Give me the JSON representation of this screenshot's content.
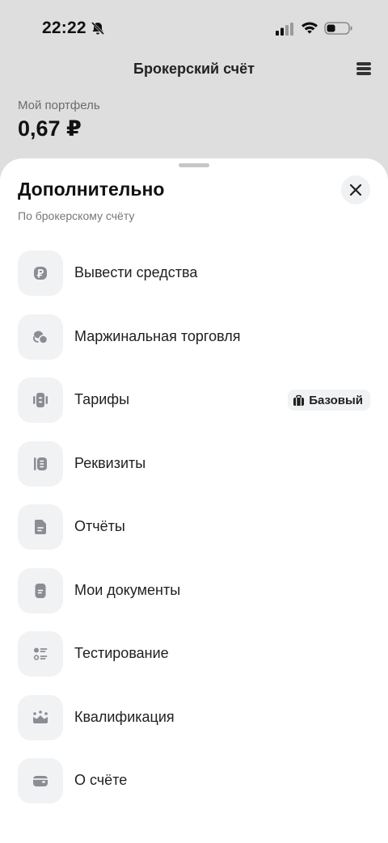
{
  "status_bar": {
    "time": "22:22"
  },
  "header": {
    "title": "Брокерский счёт"
  },
  "portfolio": {
    "label": "Мой портфель",
    "value": "0,67 ₽"
  },
  "sheet": {
    "title": "Дополнительно",
    "subtitle": "По брокерскому счёту",
    "items": [
      {
        "label": "Вывести средства",
        "icon": "ruble-icon"
      },
      {
        "label": "Маржинальная торговля",
        "icon": "coins-icon"
      },
      {
        "label": "Тарифы",
        "icon": "tariff-icon",
        "badge": "Базовый",
        "badge_icon": "briefcase-icon"
      },
      {
        "label": "Реквизиты",
        "icon": "requisites-icon"
      },
      {
        "label": "Отчёты",
        "icon": "report-document-icon"
      },
      {
        "label": "Мои документы",
        "icon": "documents-icon"
      },
      {
        "label": "Тестирование",
        "icon": "checklist-icon"
      },
      {
        "label": "Квалификация",
        "icon": "crown-icon"
      },
      {
        "label": "О счёте",
        "icon": "wallet-icon"
      }
    ]
  },
  "colors": {
    "background": "#dedede",
    "sheet": "#ffffff",
    "icon_tile": "#f1f2f4",
    "icon_gray": "#8a8d93"
  }
}
